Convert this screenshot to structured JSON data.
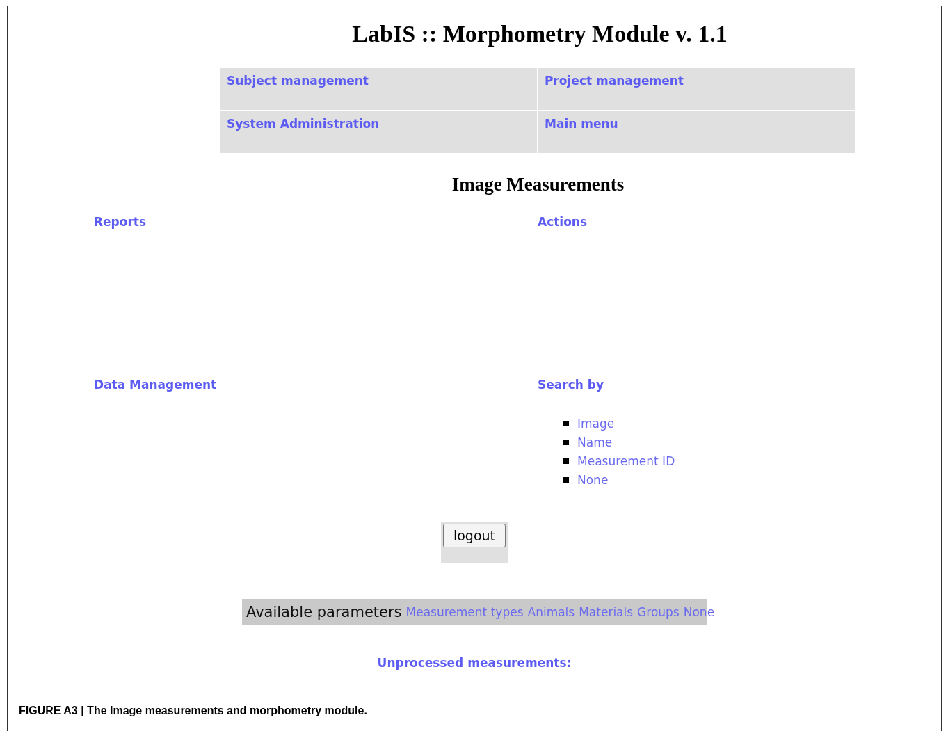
{
  "title": "LabIS :: Morphometry Module v. 1.1",
  "nav": [
    {
      "label": "Subject management"
    },
    {
      "label": "Project management"
    },
    {
      "label": "System Administration"
    },
    {
      "label": "Main menu"
    }
  ],
  "heading": "Image Measurements",
  "sections": [
    {
      "label": "Reports"
    },
    {
      "label": "Actions"
    },
    {
      "label": "Data Management"
    },
    {
      "label": "Search by"
    }
  ],
  "search_by": [
    "Image",
    "Name",
    "Measurement ID",
    "None"
  ],
  "logout_button": "logout",
  "parameters": {
    "label": "Available parameters",
    "links": [
      "Measurement types",
      "Animals",
      "Materials",
      "Groups",
      "None"
    ]
  },
  "unprocessed": "Unprocessed measurements:",
  "caption": "FIGURE A3 | The Image measurements and morphometry module."
}
